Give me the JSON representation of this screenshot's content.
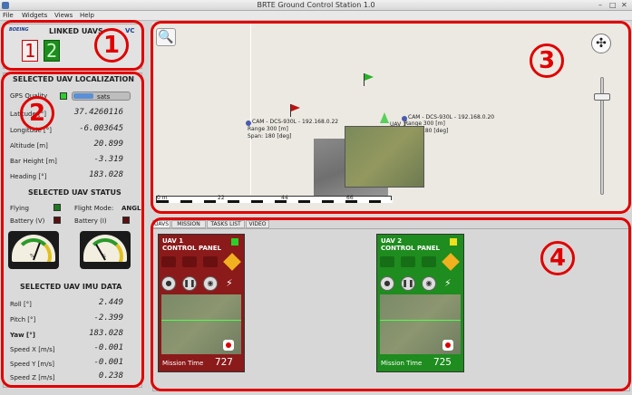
{
  "window": {
    "title": "BRTE Ground Control Station 1.0"
  },
  "menu": [
    "File",
    "Widgets",
    "Views",
    "Help"
  ],
  "linked": {
    "title": "LINKED UAVS",
    "logo": "BOEING",
    "vc": "VC",
    "uavs": [
      "1",
      "2"
    ]
  },
  "localization": {
    "title": "SELECTED UAV LOCALIZATION",
    "gps_label": "GPS Quality",
    "sats": "sats",
    "rows": [
      {
        "label": "Latitude [°]",
        "value": "37.4260116"
      },
      {
        "label": "Longitude [°]",
        "value": "-6.003645"
      },
      {
        "label": "Altitude [m]",
        "value": "20.899"
      },
      {
        "label": "Bar Height [m]",
        "value": "-3.319"
      },
      {
        "label": "Heading [°]",
        "value": "183.028"
      }
    ]
  },
  "status": {
    "title": "SELECTED UAV STATUS",
    "flying": "Flying",
    "flight_mode": "Flight Mode:",
    "flight_mode_value": "ANGL",
    "battery_v": "Battery (V)",
    "battery_i": "Battery (I)"
  },
  "gauges": {
    "unit": "%"
  },
  "imu": {
    "title": "SELECTED UAV IMU DATA",
    "rows": [
      {
        "label": "Roll [°]",
        "value": "2.449"
      },
      {
        "label": "Pitch [°]",
        "value": "-2.399"
      },
      {
        "label": "Yaw [°]",
        "value": "183.028"
      },
      {
        "label": "Speed X [m/s]",
        "value": "-0.001"
      },
      {
        "label": "Speed Y [m/s]",
        "value": "-0.001"
      },
      {
        "label": "Speed Z [m/s]",
        "value": "0.238"
      }
    ]
  },
  "map": {
    "cams": [
      {
        "lines": [
          "CAM - DCS-930L - 192.168.0.22",
          "Range 300 [m]",
          "Span: 180 [deg]"
        ]
      },
      {
        "lines": [
          "CAM - DCS-930L - 192.168.0.20",
          "Range 300 [m]",
          "Span: 180 [deg]"
        ]
      }
    ],
    "uav_label": "UAV 1",
    "scale_labels": [
      "0 m",
      "22",
      "44",
      "66"
    ]
  },
  "tabs": [
    "UAVS",
    "MISSION",
    "TASKS LIST",
    "VIDEO"
  ],
  "panels": [
    {
      "title_1": "UAV 1",
      "title_2": "CONTROL PANEL",
      "mission_label": "Mission Time",
      "mission_time": "727",
      "color": "#8b1a1a",
      "indicator": "#2ad02a"
    },
    {
      "title_1": "UAV 2",
      "title_2": "CONTROL PANEL",
      "mission_label": "Mission Time",
      "mission_time": "725",
      "color": "#1e8c1e",
      "indicator": "#f0e020"
    }
  ],
  "annotations": [
    "1",
    "2",
    "3",
    "4"
  ]
}
